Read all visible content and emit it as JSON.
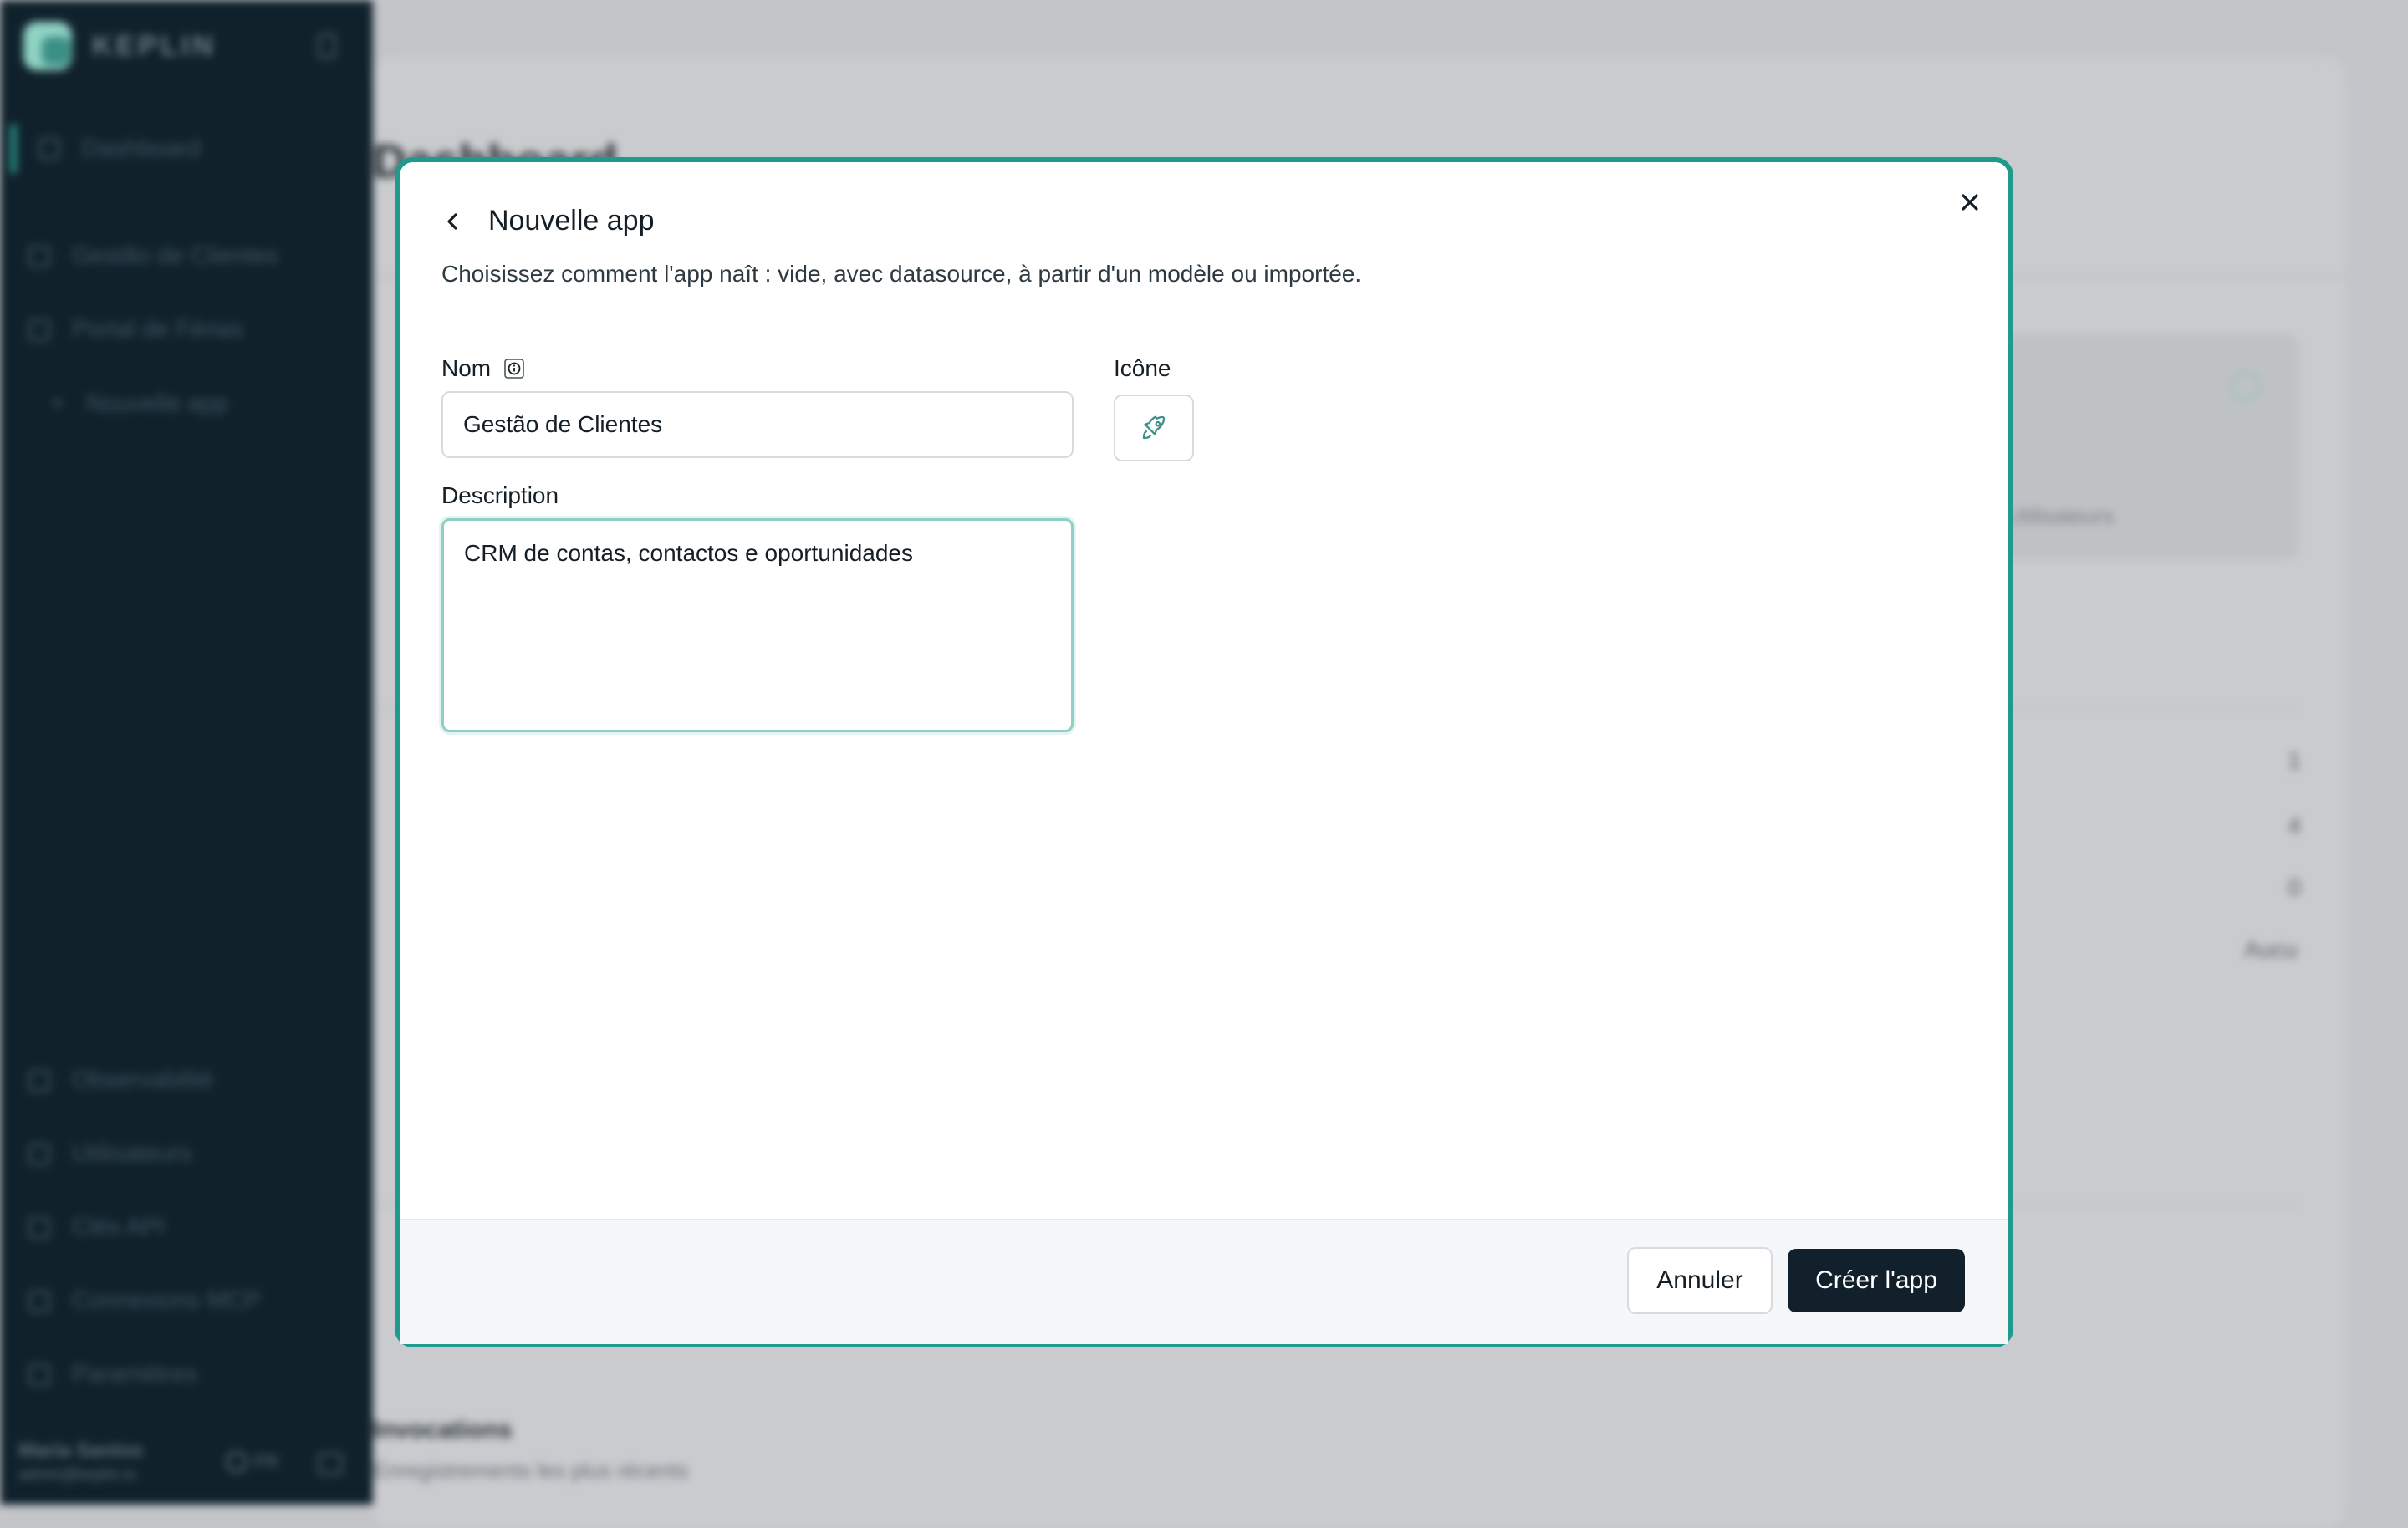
{
  "sidebar": {
    "brand": "KEPLIN",
    "nav_main": [
      {
        "label": "Dashboard"
      }
    ],
    "nav_apps": [
      {
        "label": "Gestão de Clientes"
      },
      {
        "label": "Portal de Férias"
      },
      {
        "label": "Nouvelle app",
        "icon": "+"
      }
    ],
    "nav_bottom": [
      {
        "label": "Observabilité"
      },
      {
        "label": "Utilisateurs"
      },
      {
        "label": "Clés API"
      },
      {
        "label": "Connexions MCP"
      },
      {
        "label": "Paramètres"
      }
    ],
    "user": {
      "name": "Maria Santos",
      "email": "admin@keplin.io"
    },
    "language": "FR"
  },
  "background": {
    "page_title": "Dashboard",
    "stat_label": "Utilisateurs",
    "rows": [
      "1",
      "4",
      "0",
      "Aucu"
    ],
    "recent_title": "Invocations",
    "recent_sub": "Enregistrements les plus récents"
  },
  "modal": {
    "title": "Nouvelle app",
    "description": "Choisissez comment l'app naît : vide, avec datasource, à partir d'un modèle ou importée.",
    "fields": {
      "name_label": "Nom",
      "name_value": "Gestão de Clientes",
      "icon_label": "Icône",
      "icon_value": "rocket-icon",
      "description_label": "Description",
      "description_value": "CRM de contas, contactos e oportunidades"
    },
    "buttons": {
      "cancel": "Annuler",
      "create": "Créer l'app"
    }
  },
  "colors": {
    "accent": "#1f9a8c",
    "primary_button": "#11202a",
    "sidebar_bg": "#10212b"
  }
}
